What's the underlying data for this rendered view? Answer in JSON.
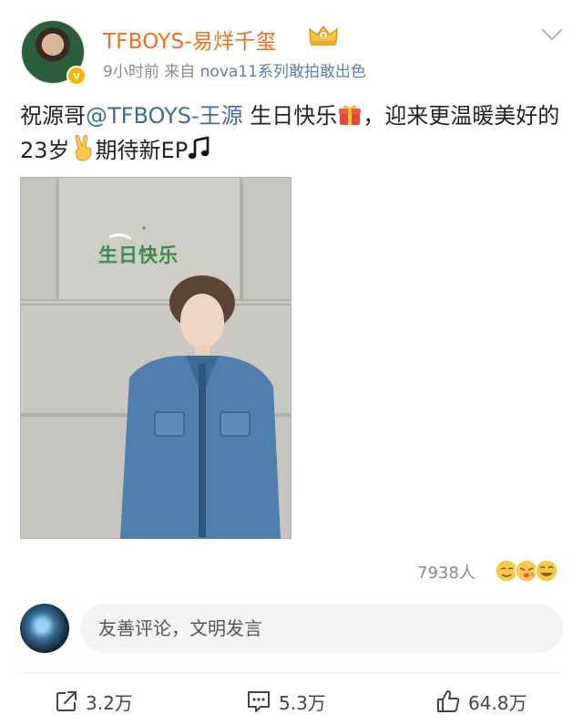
{
  "post": {
    "author": "TFBOYS-易烊千玺",
    "time": "9小时前",
    "source_prefix": "来自",
    "source_device": "nova11系列敢拍敢出色",
    "text_part1": "祝源哥",
    "mention": "@TFBOYS-王源",
    "text_part2": " 生日快乐",
    "text_part3": "，迎来更温暖美好的23岁",
    "text_part4": "期待新EP",
    "photo_caption": "生日快乐"
  },
  "reactions": {
    "count": "7938人"
  },
  "comment": {
    "placeholder": "友善评论，文明发言"
  },
  "actions": {
    "share": "3.2万",
    "comment": "5.3万",
    "like": "64.8万"
  },
  "colors": {
    "username": "#f06f1d",
    "mention": "#3f6aa1",
    "source": "#5a7fa8",
    "verified": "#f7b500"
  },
  "icons": [
    "verified-badge-icon",
    "crown-badge-icon",
    "chevron-down-icon",
    "gift-emoji-icon",
    "victory-hand-emoji-icon",
    "music-note-icon",
    "reaction-faces-icon",
    "share-icon",
    "comment-icon",
    "like-icon"
  ]
}
